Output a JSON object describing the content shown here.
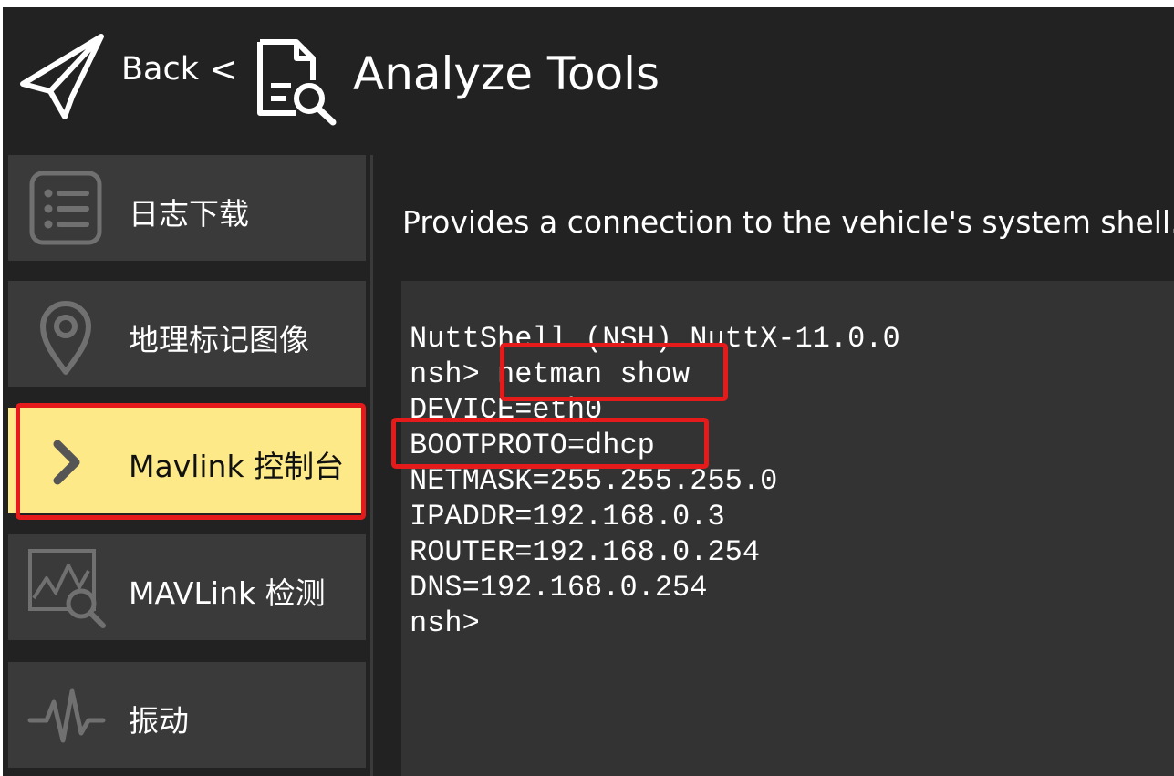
{
  "header": {
    "back_label": "Back",
    "separator": "<",
    "title": "Analyze Tools",
    "icons": [
      "paper-plane-icon",
      "analyze-document-icon"
    ]
  },
  "sidebar": {
    "items": [
      {
        "label": "日志下载",
        "icon": "list-icon",
        "active": false
      },
      {
        "label": "地理标记图像",
        "icon": "map-pin-icon",
        "active": false
      },
      {
        "label": "Mavlink 控制台",
        "icon": "chevron-right-icon",
        "active": true
      },
      {
        "label": "MAVLink 检测",
        "icon": "chart-search-icon",
        "active": false
      },
      {
        "label": "振动",
        "icon": "waveform-icon",
        "active": false
      }
    ]
  },
  "main": {
    "description": "Provides a connection to the vehicle's system shell.",
    "console_lines": [
      "NuttShell (NSH) NuttX-11.0.0",
      "nsh> netman show",
      "DEVICE=eth0",
      "BOOTPROTO=dhcp",
      "NETMASK=255.255.255.0",
      "IPADDR=192.168.0.3",
      "ROUTER=192.168.0.254",
      "DNS=192.168.0.254",
      "nsh>"
    ]
  },
  "colors": {
    "background": "#222222",
    "panel": "#3a3a3a",
    "console": "#333333",
    "active": "#fde987",
    "annotation": "#e51b1b"
  }
}
